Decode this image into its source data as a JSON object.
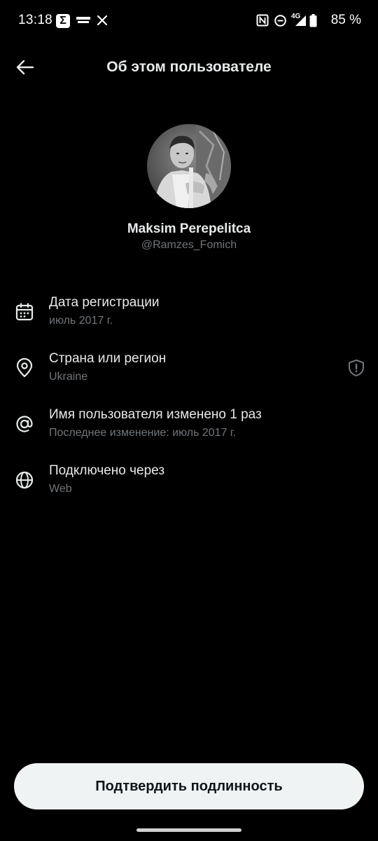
{
  "status_bar": {
    "time": "13:18",
    "network": "4G",
    "battery": "85 %"
  },
  "header": {
    "title": "Об этом пользователе"
  },
  "profile": {
    "display_name": "Maksim Perepelitca",
    "username": "@Ramzes_Fomich"
  },
  "info": {
    "registration": {
      "title": "Дата регистрации",
      "value": "июль 2017 г.",
      "icon": "calendar-icon"
    },
    "country": {
      "title": "Страна или регион",
      "value": "Ukraine",
      "icon": "location-pin-icon"
    },
    "username_changes": {
      "title": "Имя пользователя изменено 1 раз",
      "value": "Последнее изменение: июль 2017 г.",
      "icon": "at-sign-icon"
    },
    "connected_via": {
      "title": "Подключено через",
      "value": "Web",
      "icon": "globe-icon"
    }
  },
  "actions": {
    "verify_label": "Подтвердить подлинность"
  },
  "colors": {
    "background": "#000000",
    "primary_text": "#e7e9ea",
    "secondary_text": "#71767b",
    "button_bg": "#eff3f4",
    "button_text": "#0f1419"
  }
}
